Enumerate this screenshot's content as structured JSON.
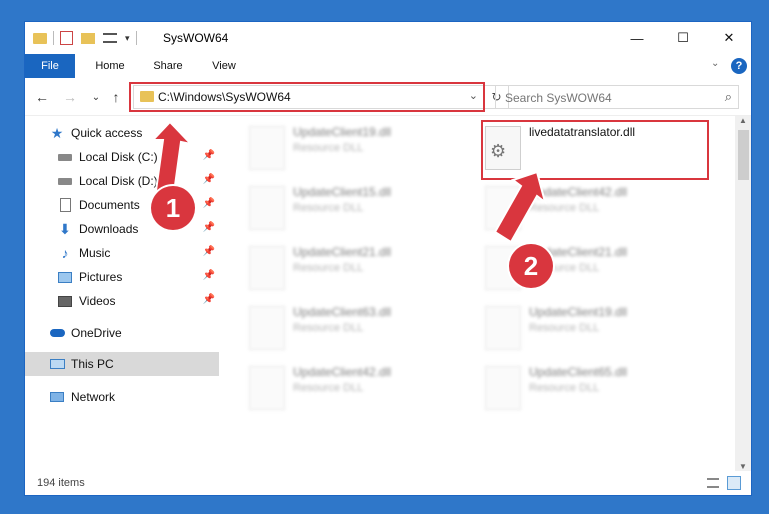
{
  "window": {
    "title": "SysWOW64",
    "controls": {
      "minimize": "—",
      "maximize": "☐",
      "close": "✕"
    }
  },
  "ribbon": {
    "tabs": [
      "File",
      "Home",
      "Share",
      "View"
    ],
    "help": "?"
  },
  "address_bar": {
    "path": "C:\\Windows\\SysWOW64",
    "search_placeholder": "Search SysWOW64"
  },
  "sidebar": {
    "items": [
      {
        "label": "Quick access",
        "icon": "star-icon"
      },
      {
        "label": "Local Disk (C:)",
        "icon": "drive-icon"
      },
      {
        "label": "Local Disk (D:)",
        "icon": "drive-icon"
      },
      {
        "label": "Documents",
        "icon": "documents-icon"
      },
      {
        "label": "Downloads",
        "icon": "download-icon"
      },
      {
        "label": "Music",
        "icon": "music-icon"
      },
      {
        "label": "Pictures",
        "icon": "pictures-icon"
      },
      {
        "label": "Videos",
        "icon": "videos-icon"
      },
      {
        "label": "OneDrive",
        "icon": "cloud-icon"
      },
      {
        "label": "This PC",
        "icon": "computer-icon"
      },
      {
        "label": "Network",
        "icon": "network-icon"
      }
    ]
  },
  "files": [
    {
      "name": "UpdateClient19.dll",
      "type": "Resource DLL"
    },
    {
      "name": "livedatatranslator.dll",
      "type": ""
    },
    {
      "name": "UpdateClient15.dll",
      "type": "Resource DLL"
    },
    {
      "name": "UpdateClient42.dll",
      "type": "Resource DLL"
    },
    {
      "name": "UpdateClient21.dll",
      "type": "Resource DLL"
    },
    {
      "name": "UpdateClient21.dll",
      "type": "Resource DLL"
    },
    {
      "name": "UpdateClient63.dll",
      "type": "Resource DLL"
    },
    {
      "name": "UpdateClient19.dll",
      "type": "Resource DLL"
    },
    {
      "name": "UpdateClient42.dll",
      "type": "Resource DLL"
    },
    {
      "name": "UpdateClient65.dll",
      "type": "Resource DLL"
    }
  ],
  "status_bar": {
    "count": "194 items"
  },
  "annotations": {
    "step1": "1",
    "step2": "2"
  },
  "colors": {
    "accent": "#1a66c0",
    "highlight": "#d9363e"
  }
}
